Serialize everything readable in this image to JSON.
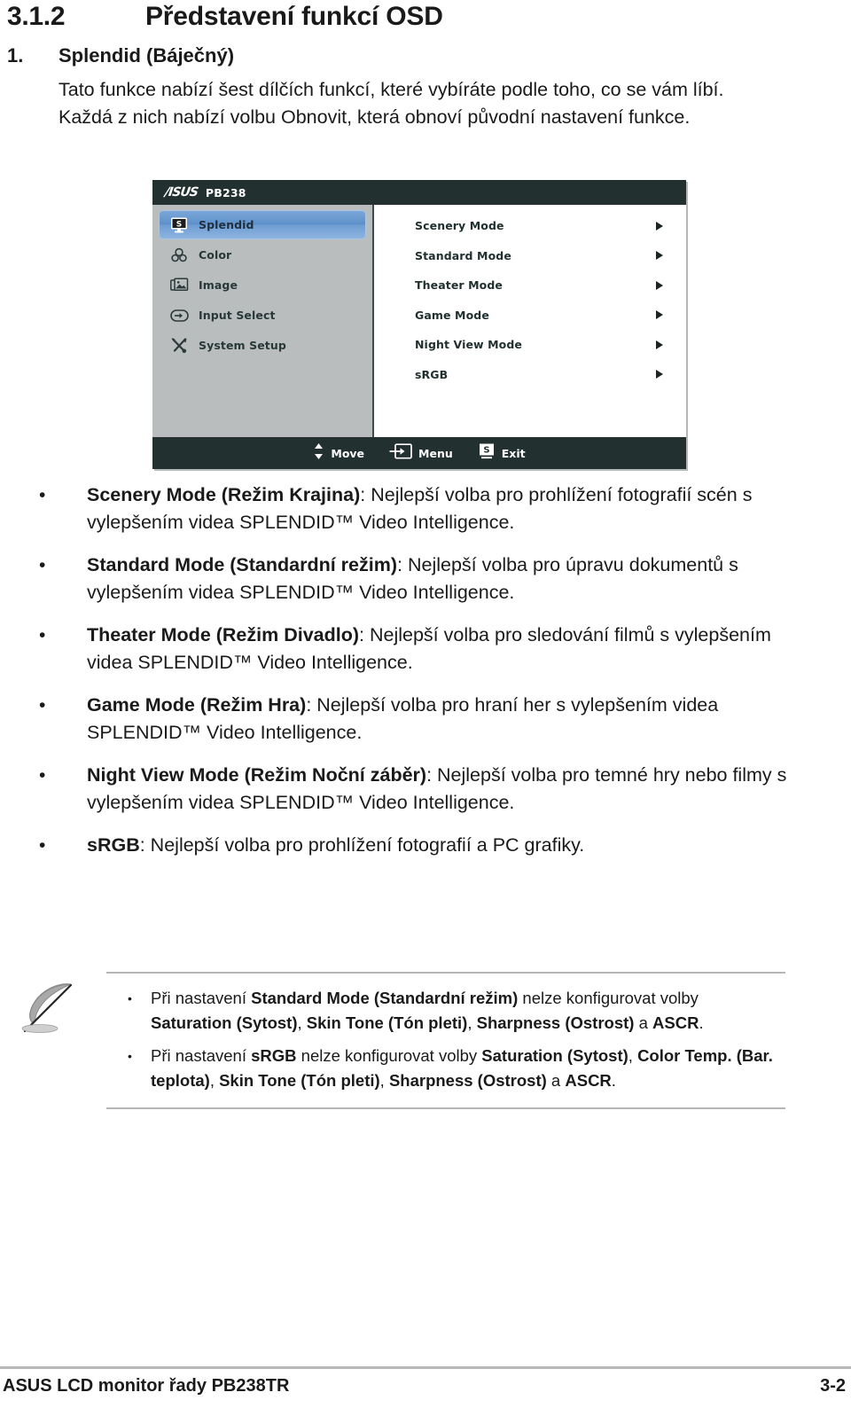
{
  "heading": {
    "number": "3.1.2",
    "title": "Představení funkcí OSD"
  },
  "numbered_item": {
    "marker": "1.",
    "label": "Splendid (Báječný)",
    "body": "Tato funkce nabízí šest dílčích funkcí, které vybíráte podle toho, co se vám líbí. Každá z nich nabízí volbu Obnovit, která obnoví původní nastavení funkce."
  },
  "osd": {
    "brand": "/ISUS",
    "model": "PB238",
    "nav": [
      {
        "icon": "splendid-icon",
        "label": "Splendid",
        "selected": true
      },
      {
        "icon": "color-icon",
        "label": "Color",
        "selected": false
      },
      {
        "icon": "image-icon",
        "label": "Image",
        "selected": false
      },
      {
        "icon": "input-select-icon",
        "label": "Input Select",
        "selected": false
      },
      {
        "icon": "system-setup-icon",
        "label": "System Setup",
        "selected": false
      }
    ],
    "options": [
      {
        "label": "Scenery Mode"
      },
      {
        "label": "Standard Mode"
      },
      {
        "label": "Theater Mode"
      },
      {
        "label": "Game Mode"
      },
      {
        "label": "Night View Mode"
      },
      {
        "label": "sRGB"
      }
    ],
    "footer": [
      {
        "icon": "up-down-arrows-icon",
        "label": "Move"
      },
      {
        "icon": "enter-menu-icon",
        "label": "Menu"
      },
      {
        "icon": "splendid-s-icon",
        "label": "Exit"
      }
    ],
    "colors": {
      "chrome": "#22302f",
      "sidebar": "#b9bdbe",
      "selected": "#6f9dd3",
      "content": "#ffffff"
    }
  },
  "bullets": [
    {
      "bold": "Scenery Mode (Režim Krajina)",
      "rest": ": Nejlepší volba pro prohlížení fotografií scén s vylepšením videa SPLENDID™ Video Intelligence."
    },
    {
      "bold": "Standard Mode (Standardní režim)",
      "rest": ": Nejlepší volba pro úpravu dokumentů s vylepšením videa SPLENDID™ Video Intelligence."
    },
    {
      "bold": "Theater Mode (Režim Divadlo)",
      "rest": ": Nejlepší volba pro sledování filmů s vylepšením videa SPLENDID™ Video Intelligence."
    },
    {
      "bold": "Game Mode (Režim Hra)",
      "rest": ": Nejlepší volba pro hraní her s vylepšením videa SPLENDID™ Video Intelligence."
    },
    {
      "bold": "Night View Mode (Režim Noční záběr)",
      "rest": ": Nejlepší volba pro temné hry nebo filmy s vylepšením videa SPLENDID™ Video Intelligence."
    },
    {
      "bold": "sRGB",
      "rest": ": Nejlepší volba pro prohlížení fotografií a PC grafiky."
    }
  ],
  "note": {
    "icon": "quill-feather-icon",
    "items": [
      {
        "p1": "Při nastavení ",
        "b1": "Standard Mode (Standardní režim)",
        "p2": " nelze konfigurovat volby ",
        "b2": "Saturation (Sytost)",
        "p3": ", ",
        "b3": "Skin Tone (Tón pleti)",
        "p4": ", ",
        "b4": "Sharpness (Ostrost)",
        "p5": " a ",
        "b5": "ASCR",
        "p6": "."
      },
      {
        "p1": "Při nastavení ",
        "b1": "sRGB",
        "p2": " nelze konfigurovat volby ",
        "b2": "Saturation (Sytost)",
        "p3": ", ",
        "b3": "Color Temp. (Bar. teplota)",
        "p4": ", ",
        "b4": "Skin Tone (Tón pleti)",
        "p5": ", ",
        "b5": "Sharpness (Ostrost)",
        "p6": " a ",
        "b6": "ASCR",
        "p7": "."
      }
    ]
  },
  "footer": {
    "left": "ASUS LCD monitor řady PB238TR",
    "page": "3-2"
  }
}
